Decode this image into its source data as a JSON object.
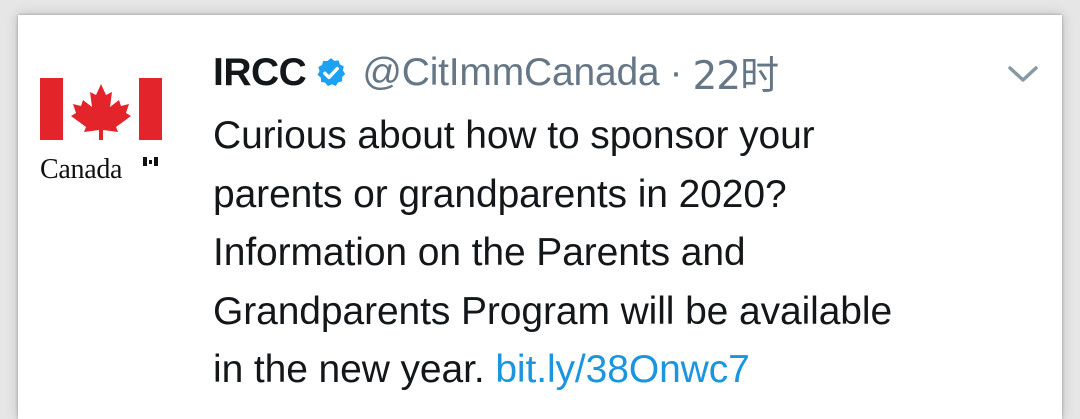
{
  "tweet": {
    "author_logo_wordmark": "Canada",
    "author_name": "IRCC",
    "author_handle": "@CitImmCanada",
    "separator": "·",
    "timestamp": "22时",
    "text_lines": [
      "Curious about how to sponsor your",
      "parents or grandparents in 2020?",
      "Information on the Parents and",
      "Grandparents Program will be available",
      "in the new year."
    ],
    "link_text": "bit.ly/38Onwc7",
    "icons": {
      "verified": "verified-badge-icon",
      "menu": "chevron-down-icon",
      "flag": "canada-flag-icon"
    },
    "colors": {
      "link": "#1b95e0",
      "verified": "#1da1f2",
      "flag_red": "#e3242b",
      "secondary_text": "#657786"
    }
  }
}
